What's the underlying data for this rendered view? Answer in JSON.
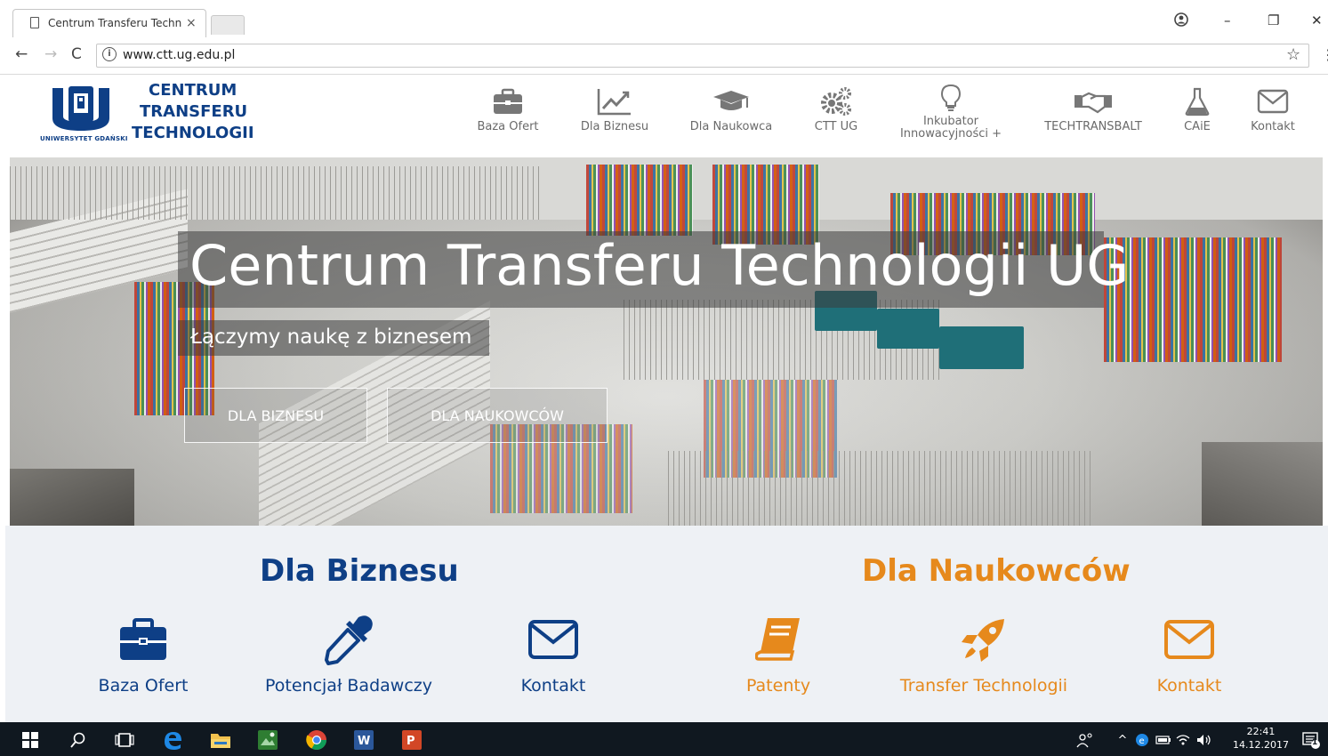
{
  "browser": {
    "tab_title": "Centrum Transferu Techn",
    "tab_close": "×",
    "url": "www.ctt.ug.edu.pl",
    "window_controls": {
      "minimize": "–",
      "restore": "❐",
      "close": "✕"
    }
  },
  "site": {
    "logo": {
      "line1": "CENTRUM",
      "line2": "TRANSFERU",
      "line3": "TECHNOLOGII",
      "university": "UNIWERSYTET GDAŃSKI"
    },
    "nav": [
      {
        "label": "Baza Ofert",
        "icon": "briefcase-icon"
      },
      {
        "label": "Dla Biznesu",
        "icon": "chart-line-icon"
      },
      {
        "label": "Dla Naukowca",
        "icon": "graduation-cap-icon"
      },
      {
        "label": "CTT UG",
        "icon": "gears-icon"
      },
      {
        "label": "Inkubator Innowacyjności +",
        "icon": "lightbulb-icon"
      },
      {
        "label": "TECHTRANSBALT",
        "icon": "handshake-icon"
      },
      {
        "label": "CAiE",
        "icon": "flask-icon"
      },
      {
        "label": "Kontakt",
        "icon": "envelope-icon"
      }
    ],
    "nav_inkubator_line1": "Inkubator",
    "nav_inkubator_line2": "Innowacyjności +",
    "hero": {
      "title": "Centrum Transferu Technologii UG",
      "subtitle": "Łączymy naukę z biznesem",
      "btn_business": "DLA BIZNESU",
      "btn_scientists": "DLA NAUKOWCÓW"
    },
    "business": {
      "title": "Dla Biznesu",
      "color": "#0e3f86",
      "cards": [
        {
          "label": "Baza Ofert",
          "icon": "briefcase-icon"
        },
        {
          "label": "Potencjał Badawczy",
          "icon": "pipette-icon"
        },
        {
          "label": "Kontakt",
          "icon": "envelope-icon"
        }
      ]
    },
    "scientists": {
      "title": "Dla Naukowców",
      "color": "#e6891c",
      "cards": [
        {
          "label": "Patenty",
          "icon": "book-icon"
        },
        {
          "label": "Transfer Technologii",
          "icon": "rocket-icon"
        },
        {
          "label": "Kontakt",
          "icon": "envelope-icon"
        }
      ]
    }
  },
  "taskbar": {
    "time": "22:41",
    "date": "14.12.2017",
    "notification_count": "1"
  }
}
